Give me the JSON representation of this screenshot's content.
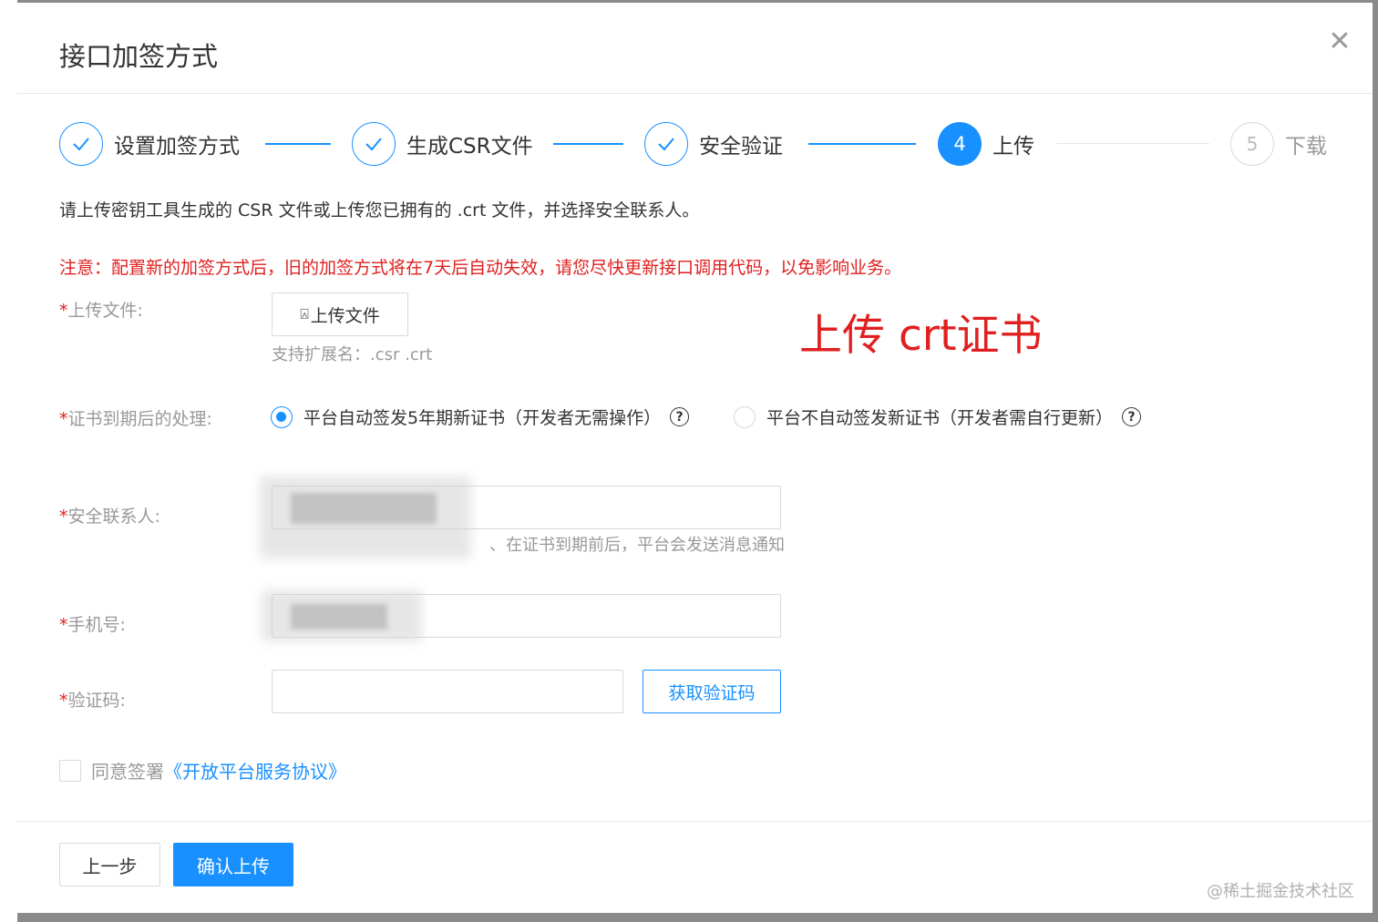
{
  "dialog": {
    "title": "接口加签方式",
    "close_glyph": "✕"
  },
  "steps": [
    {
      "label": "设置加签方式",
      "state": "done",
      "mark": "✓"
    },
    {
      "label": "生成CSR文件",
      "state": "done",
      "mark": "✓"
    },
    {
      "label": "安全验证",
      "state": "done",
      "mark": "✓"
    },
    {
      "label": "上传",
      "state": "active",
      "mark": "4"
    },
    {
      "label": "下载",
      "state": "wait",
      "mark": "5"
    }
  ],
  "intro": "请上传密钥工具生成的 CSR 文件或上传您已拥有的 .crt 文件，并选择安全联系人。",
  "notice": "注意：配置新的加签方式后，旧的加签方式将在7天后自动失效，请您尽快更新接口调用代码，以免影响业务。",
  "form": {
    "required_mark": "*",
    "upload": {
      "label": "上传文件:",
      "button": "上传文件",
      "hint": "支持扩展名：.csr .crt"
    },
    "annotation": "上传 crt证书",
    "expiry": {
      "label": "证书到期后的处理:",
      "options": [
        {
          "text": "平台自动签发5年期新证书（开发者无需操作）",
          "checked": true
        },
        {
          "text": "平台不自动签发新证书（开发者需自行更新）",
          "checked": false
        }
      ],
      "help_glyph": "?"
    },
    "contact": {
      "label": "安全联系人:",
      "hint": "、在证书到期前后，平台会发送消息通知"
    },
    "phone": {
      "label": "手机号:"
    },
    "code": {
      "label": "验证码:",
      "button": "获取验证码"
    },
    "agree": {
      "text": "同意签署",
      "link": "《开放平台服务协议》"
    }
  },
  "footer": {
    "prev": "上一步",
    "confirm": "确认上传"
  },
  "watermark": "@稀土掘金技术社区",
  "colors": {
    "primary": "#1890ff",
    "warning": "#e02020"
  }
}
